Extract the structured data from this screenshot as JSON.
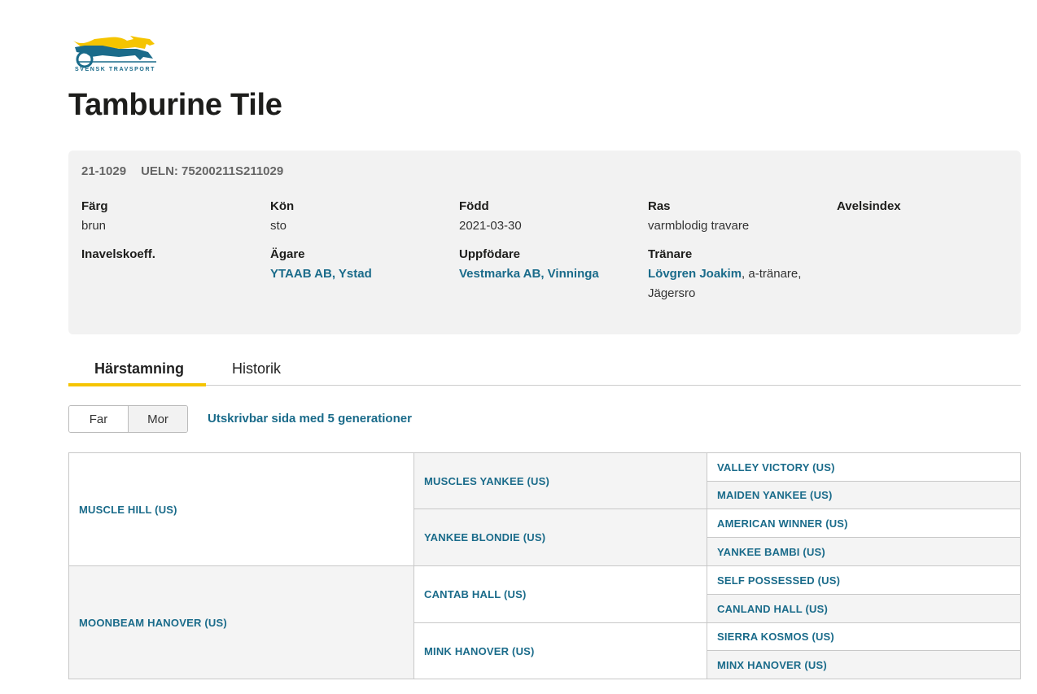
{
  "logo": {
    "text": "SVENSK TRAVSPORT"
  },
  "horse": {
    "name": "Tamburine Tile"
  },
  "info": {
    "reg_no": "21-1029",
    "ueln": "UELN: 75200211S211029",
    "farg": {
      "label": "Färg",
      "value": "brun"
    },
    "kon": {
      "label": "Kön",
      "value": "sto"
    },
    "fodd": {
      "label": "Född",
      "value": "2021-03-30"
    },
    "ras": {
      "label": "Ras",
      "value": "varmblodig travare"
    },
    "avelsindex": {
      "label": "Avelsindex"
    },
    "inavel": {
      "label": "Inavelskoeff."
    },
    "agare": {
      "label": "Ägare",
      "value": "YTAAB AB, Ystad"
    },
    "uppfodare": {
      "label": "Uppfödare",
      "value": "Vestmarka AB, Vinninga"
    },
    "tranare": {
      "label": "Tränare",
      "name": "Lövgren Joakim",
      "rest": ", a-tränare, Jägersro"
    }
  },
  "tabs": [
    {
      "label": "Härstamning",
      "active": true
    },
    {
      "label": "Historik",
      "active": false
    }
  ],
  "toggle": {
    "far": "Far",
    "mor": "Mor",
    "selected": "Far"
  },
  "print_link": "Utskrivbar sida med 5 generationer",
  "pedigree": {
    "gen1": [
      "MUSCLE HILL (US)",
      "MOONBEAM HANOVER (US)"
    ],
    "gen2": [
      "MUSCLES YANKEE (US)",
      "YANKEE BLONDIE (US)",
      "CANTAB HALL (US)",
      "MINK HANOVER (US)"
    ],
    "gen3": [
      "VALLEY VICTORY (US)",
      "MAIDEN YANKEE (US)",
      "AMERICAN WINNER (US)",
      "YANKEE BAMBI (US)",
      "SELF POSSESSED (US)",
      "CANLAND HALL (US)",
      "SIERRA KOSMOS (US)",
      "MINX HANOVER (US)"
    ]
  },
  "colors": {
    "accent": "#f5c400",
    "link": "#1a6b8a",
    "panel": "#f2f2f2"
  }
}
